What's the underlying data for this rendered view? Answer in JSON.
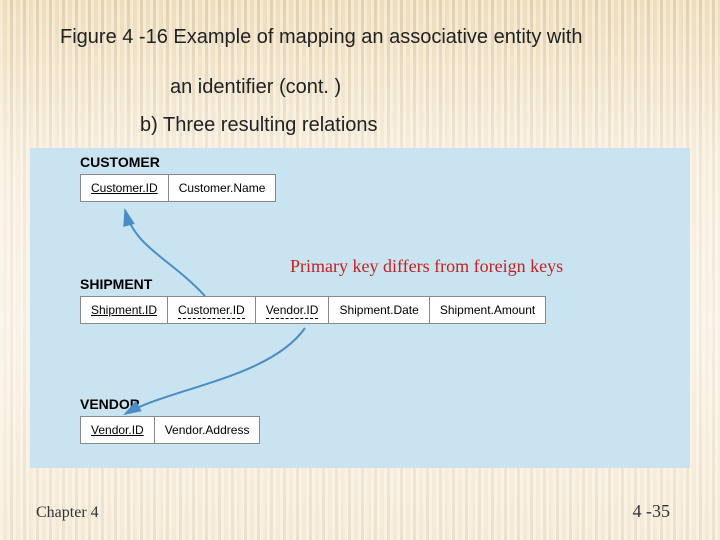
{
  "title_line1": "Figure 4 -16 Example of mapping an associative entity with",
  "title_line2": "an identifier (cont. )",
  "subtitle": "b) Three resulting relations",
  "annotation": "Primary key differs from foreign keys",
  "tables": {
    "customer": {
      "label": "CUSTOMER",
      "cols": [
        "Customer.ID",
        "Customer.Name"
      ]
    },
    "shipment": {
      "label": "SHIPMENT",
      "cols": [
        "Shipment.ID",
        "Customer.ID",
        "Vendor.ID",
        "Shipment.Date",
        "Shipment.Amount"
      ]
    },
    "vendor": {
      "label": "VENDOR",
      "cols": [
        "Vendor.ID",
        "Vendor.Address"
      ]
    }
  },
  "footer": {
    "left": "Chapter 4",
    "right": "4 -35"
  }
}
